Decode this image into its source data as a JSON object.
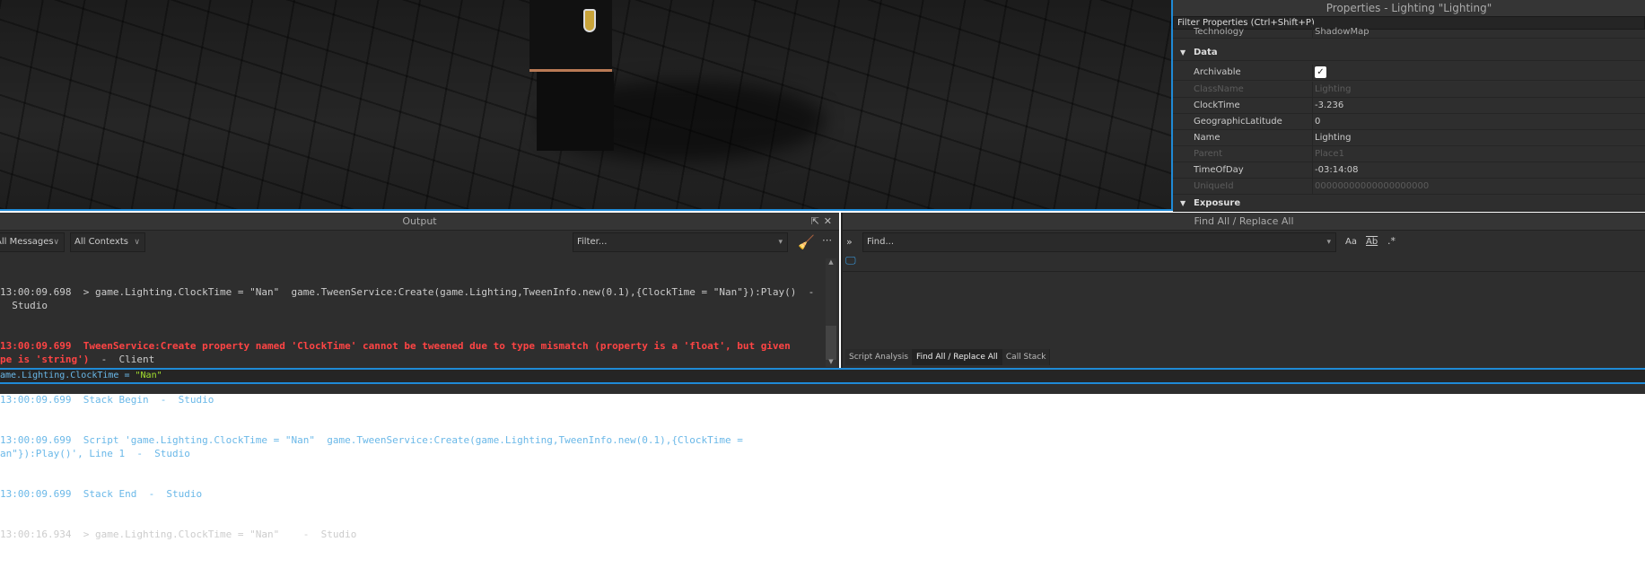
{
  "properties": {
    "title": "Properties - Lighting \"Lighting\"",
    "filter_placeholder": "Filter Properties (Ctrl+Shift+P)",
    "rows": [
      {
        "name": "Technology",
        "value": "ShadowMap"
      },
      {
        "name": "Archivable",
        "value": "true"
      },
      {
        "name": "ClassName",
        "value": "Lighting"
      },
      {
        "name": "ClockTime",
        "value": "-3.236"
      },
      {
        "name": "GeographicLatitude",
        "value": "0"
      },
      {
        "name": "Name",
        "value": "Lighting"
      },
      {
        "name": "Parent",
        "value": "Place1"
      },
      {
        "name": "TimeOfDay",
        "value": "-03:14:08"
      },
      {
        "name": "UniqueId",
        "value": "00000000000000000000"
      }
    ],
    "categories": [
      "Data",
      "Exposure"
    ]
  },
  "output": {
    "title": "Output",
    "messages_filter": "All Messages",
    "contexts_filter": "All Contexts",
    "filter_placeholder": "Filter...",
    "lines": [
      {
        "type": "normal",
        "text": "13:00:09.698  > game.Lighting.ClockTime = \"Nan\"  game.TweenService:Create(game.Lighting,TweenInfo.new(0.1),{ClockTime = \"Nan\"}):Play()  -\n  Studio"
      },
      {
        "type": "err",
        "text": "13:00:09.699  TweenService:Create property named 'ClockTime' cannot be tweened due to type mismatch (property is a 'float', but given\npe is 'string')",
        "suffix": "  -  Client"
      },
      {
        "type": "info",
        "text": "13:00:09.699  Stack Begin  -  Studio"
      },
      {
        "type": "info",
        "text": "13:00:09.699  Script 'game.Lighting.ClockTime = \"Nan\"  game.TweenService:Create(game.Lighting,TweenInfo.new(0.1),{ClockTime =\nan\"}):Play()', Line 1  -  Studio"
      },
      {
        "type": "info",
        "text": "13:00:09.699  Stack End  -  Studio"
      },
      {
        "type": "normal",
        "text": "13:00:16.934  > game.Lighting.ClockTime = \"Nan\"    -  Studio"
      }
    ]
  },
  "command_bar": {
    "prefix": "ame.Lighting.ClockTime = ",
    "string": "\"Nan\""
  },
  "find": {
    "title": "Find All / Replace All",
    "find_placeholder": "Find...",
    "match_case": "Aa",
    "whole_word": "Ab",
    "regex": ".*",
    "tabs": [
      "Script Analysis",
      "Find All / Replace All",
      "Call Stack"
    ],
    "active_tab": "Find All / Replace All"
  },
  "colors": {
    "accent": "#1f8ad6",
    "error": "#ff4444",
    "info": "#6ab8e8",
    "string": "#a6e22e"
  }
}
